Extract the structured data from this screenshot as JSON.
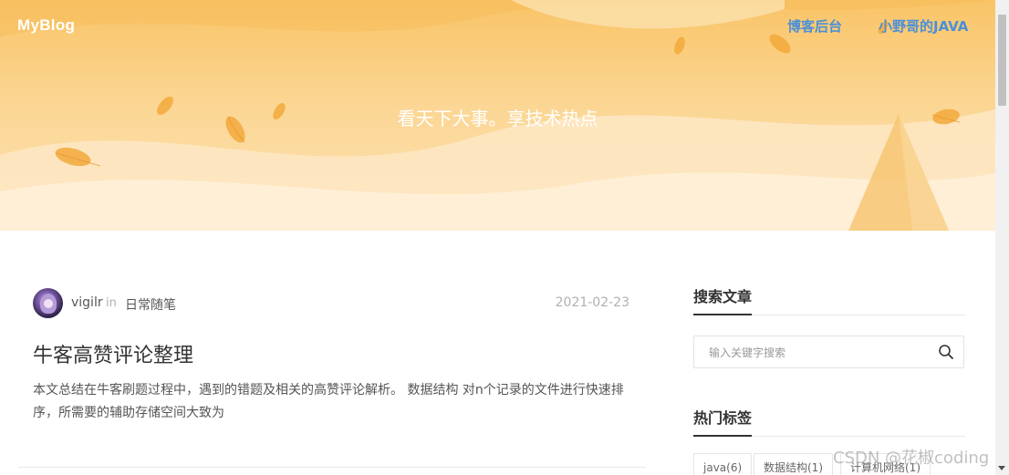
{
  "header": {
    "logo": "MyBlog",
    "nav": {
      "admin": "博客后台",
      "author": "小野哥的JAVA"
    },
    "slogan": "看天下大事。享技术热点"
  },
  "post": {
    "author": "vigilr",
    "in_word": "in",
    "category": "日常随笔",
    "date": "2021-02-23",
    "title": "牛客高赞评论整理",
    "excerpt": "本文总结在牛客刷题过程中，遇到的错题及相关的高赞评论解析。 数据结构 对n个记录的文件进行快速排序，所需要的辅助存储空间大致为"
  },
  "sidebar": {
    "search": {
      "title": "搜索文章",
      "placeholder": "输入关键字搜索"
    },
    "tags": {
      "title": "热门标签",
      "items": [
        {
          "label": "java(6)"
        },
        {
          "label": "数据结构(1)"
        },
        {
          "label": "计算机网络(1)"
        }
      ]
    }
  },
  "watermark": "CSDN @花椒coding",
  "colors": {
    "nav_link": "#4a90d9",
    "hero_top": "#f9c467",
    "hero_bottom": "#fde3b6"
  }
}
